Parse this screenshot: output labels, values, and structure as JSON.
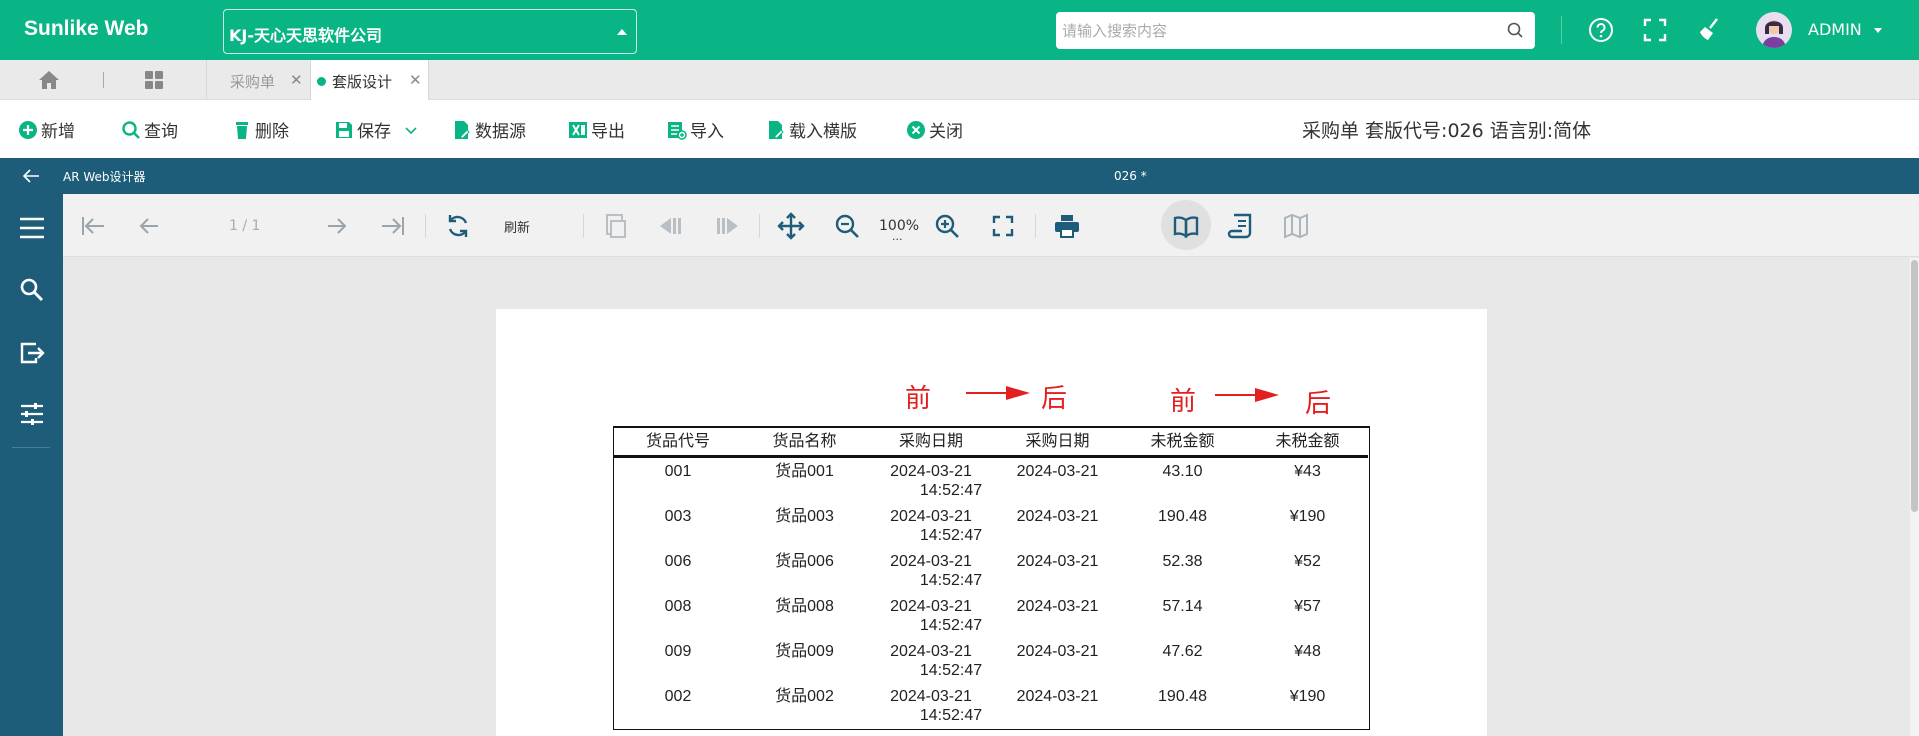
{
  "header": {
    "brand": "Sunlike Web",
    "company": "KJ-天心天思软件公司",
    "search_placeholder": "请输入搜索内容",
    "user": "ADMIN",
    "icons": [
      "help-icon",
      "fullscreen-icon",
      "broom-icon"
    ]
  },
  "tabs": [
    {
      "label": "采购单",
      "active": false
    },
    {
      "label": "套版设计",
      "active": true
    }
  ],
  "actions": {
    "items": [
      "新增",
      "查询",
      "删除",
      "保存",
      "数据源",
      "导出",
      "导入",
      "载入横版",
      "关闭"
    ],
    "title": "采购单 套版代号:026 语言别:简体"
  },
  "designer": {
    "name": "AR Web设计器",
    "doc": "026 *"
  },
  "viewer": {
    "page": "1 / 1",
    "refresh": "刷新",
    "zoom": "100%",
    "zoom_more": "..."
  },
  "report": {
    "annotations": [
      "前",
      "后",
      "前",
      "后"
    ],
    "columns": [
      "货品代号",
      "货品名称",
      "采购日期",
      "采购日期",
      "未税金额",
      "未税金额"
    ],
    "rows": [
      {
        "code": "001",
        "name": "货品001",
        "date1": "2024-03-21",
        "time1": "14:52:47",
        "date2": "2024-03-21",
        "amt1": "43.10",
        "amt2": "¥43"
      },
      {
        "code": "003",
        "name": "货品003",
        "date1": "2024-03-21",
        "time1": "14:52:47",
        "date2": "2024-03-21",
        "amt1": "190.48",
        "amt2": "¥190"
      },
      {
        "code": "006",
        "name": "货品006",
        "date1": "2024-03-21",
        "time1": "14:52:47",
        "date2": "2024-03-21",
        "amt1": "52.38",
        "amt2": "¥52"
      },
      {
        "code": "008",
        "name": "货品008",
        "date1": "2024-03-21",
        "time1": "14:52:47",
        "date2": "2024-03-21",
        "amt1": "57.14",
        "amt2": "¥57"
      },
      {
        "code": "009",
        "name": "货品009",
        "date1": "2024-03-21",
        "time1": "14:52:47",
        "date2": "2024-03-21",
        "amt1": "47.62",
        "amt2": "¥48"
      },
      {
        "code": "002",
        "name": "货品002",
        "date1": "2024-03-21",
        "time1": "14:52:47",
        "date2": "2024-03-21",
        "amt1": "190.48",
        "amt2": "¥190"
      }
    ]
  },
  "colors": {
    "brand": "#0ab585",
    "designer": "#1e5d79",
    "annotation": "#e32020"
  }
}
